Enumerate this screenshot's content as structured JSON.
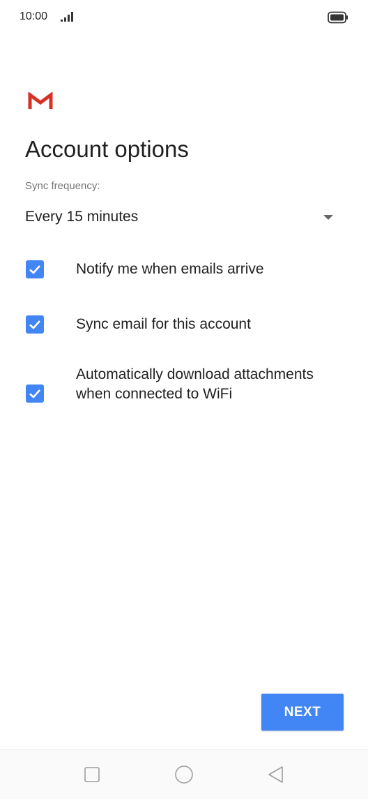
{
  "status_bar": {
    "time": "10:00",
    "icons": [
      "signal-icon",
      "battery-icon"
    ]
  },
  "logo": "gmail-logo",
  "page": {
    "title": "Account options"
  },
  "sync": {
    "label": "Sync frequency:",
    "value": "Every 15 minutes"
  },
  "options": [
    {
      "label": "Notify me when emails arrive",
      "checked": true
    },
    {
      "label": "Sync email for this account",
      "checked": true
    },
    {
      "label": "Automatically download attachments when connected to WiFi",
      "checked": true
    }
  ],
  "buttons": {
    "next": "NEXT"
  },
  "nav_bar": {
    "icons": [
      "recents-icon",
      "home-icon",
      "back-icon"
    ]
  },
  "colors": {
    "accent": "#4285f4",
    "gmail_red": "#d93025"
  }
}
